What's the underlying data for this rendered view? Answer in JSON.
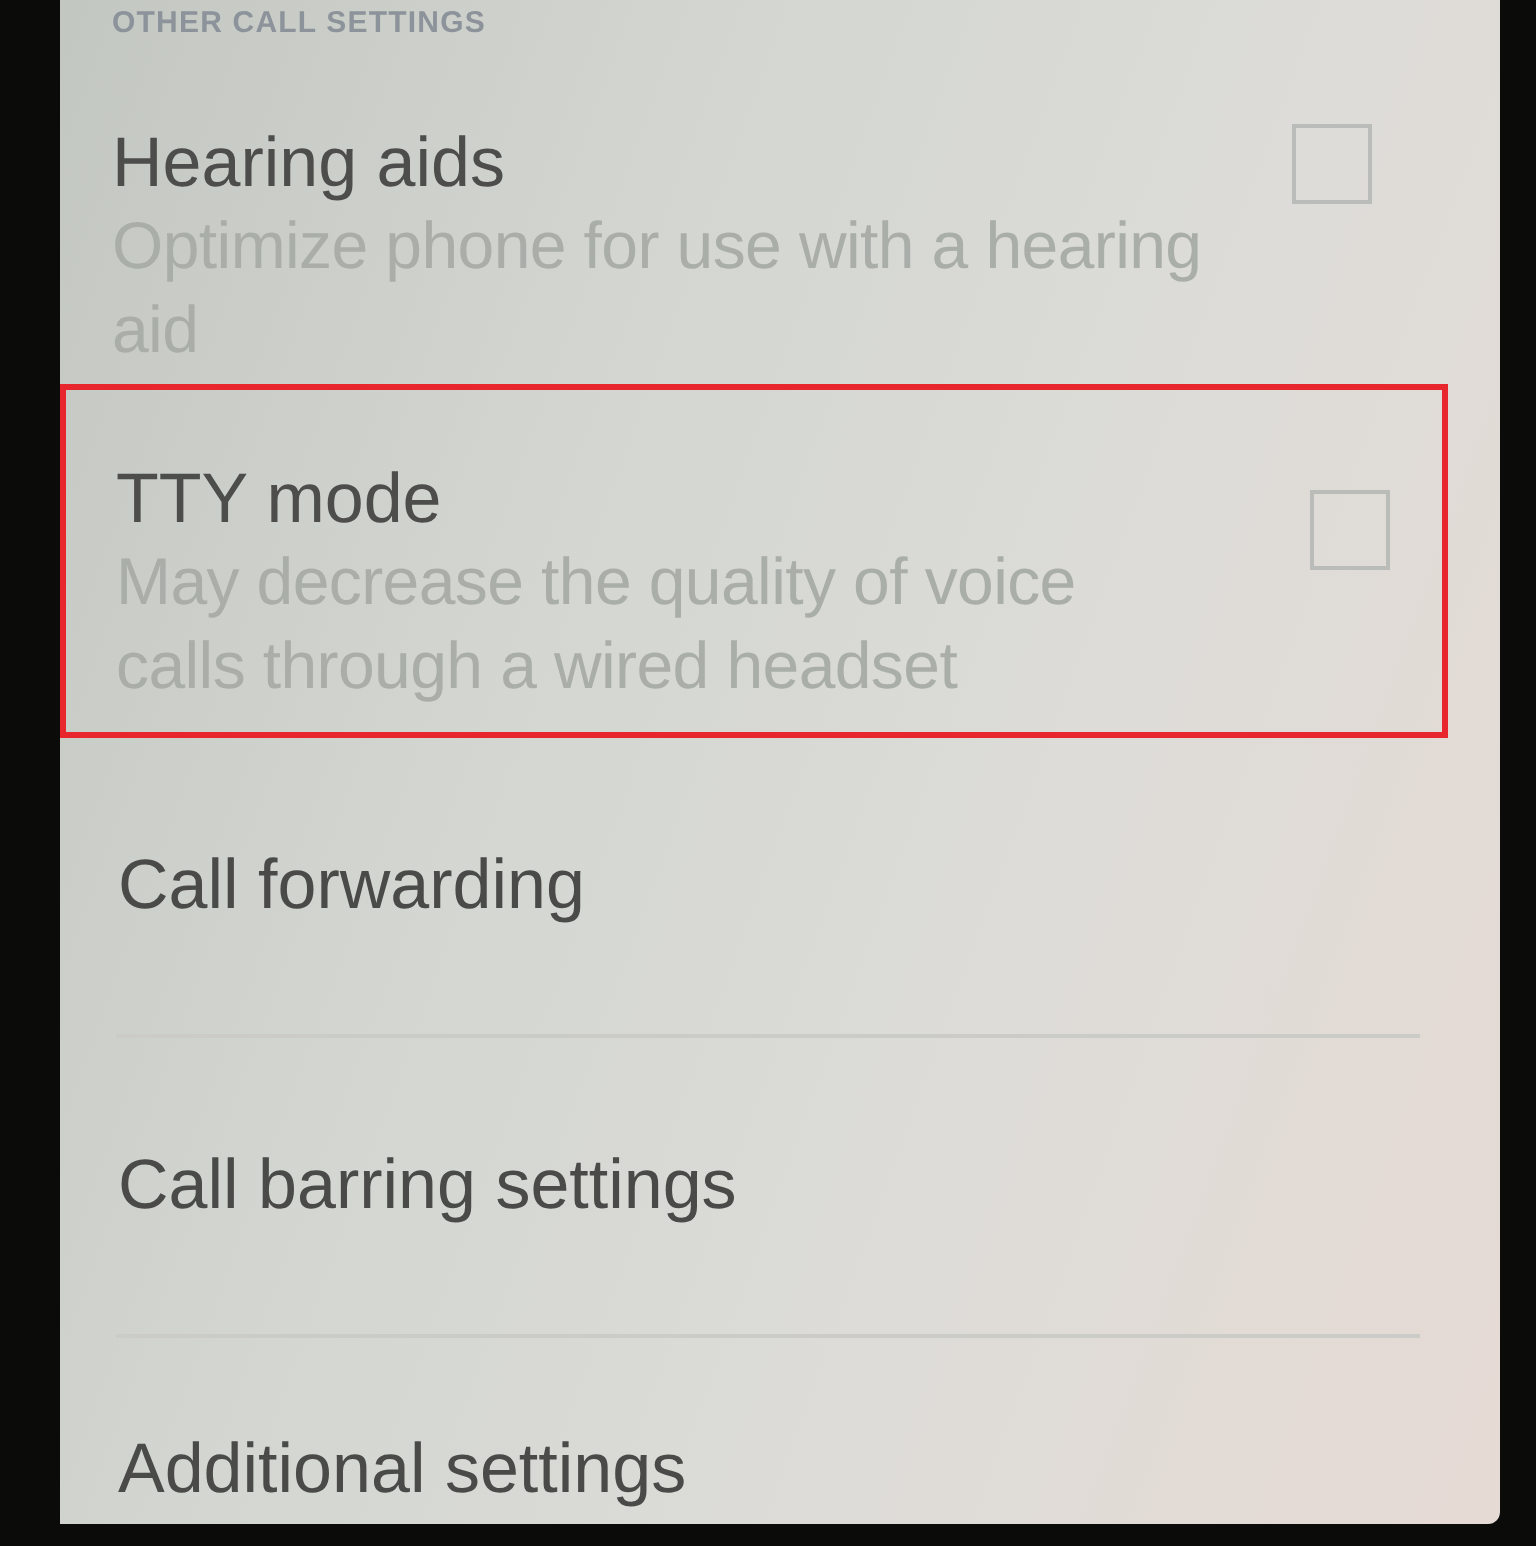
{
  "header": {
    "title": "OTHER CALL SETTINGS"
  },
  "items": [
    {
      "kind": "checkbox",
      "title": "Hearing aids",
      "summary": "Optimize phone for use with a hearing aid",
      "checked": false,
      "highlighted": false
    },
    {
      "kind": "checkbox",
      "title": "TTY mode",
      "summary": "May decrease the quality of voice calls through a wired headset",
      "checked": false,
      "highlighted": true
    },
    {
      "kind": "link",
      "title": "Call forwarding",
      "highlighted": false
    },
    {
      "kind": "link",
      "title": "Call barring settings",
      "highlighted": false
    },
    {
      "kind": "link",
      "title": "Additional settings",
      "highlighted": false
    }
  ]
}
